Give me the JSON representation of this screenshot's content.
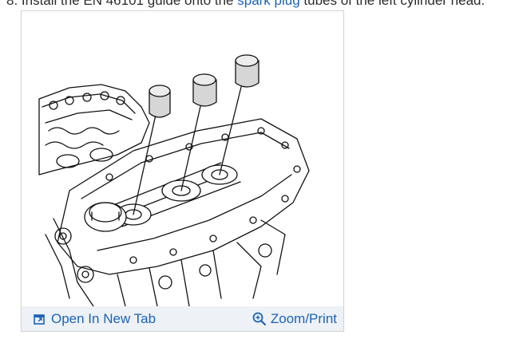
{
  "instruction": {
    "prefix": "8. Install the EN 46101",
    "middle": " guide onto the ",
    "link": "spark plug",
    "suffix": " tubes of the left cylinder head."
  },
  "figure": {
    "open_tab_label": "Open In New Tab",
    "zoom_label": "Zoom/Print",
    "link_color": "#1a64b8",
    "bar_color": "#eef1f5",
    "open_tab_icon": "open-in-new-tab-icon",
    "zoom_icon": "zoom-magnifier-icon"
  }
}
